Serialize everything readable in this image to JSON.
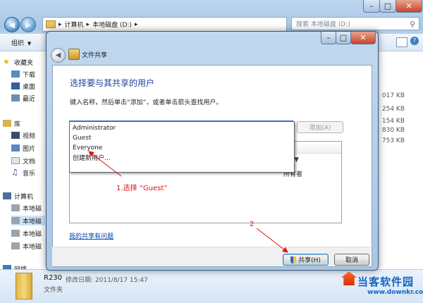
{
  "explorer": {
    "breadcrumb": [
      "计算机",
      "本地磁盘 (D:)"
    ],
    "search_placeholder": "搜索 本地磁盘 (D:)",
    "toolbar": {
      "organize_label": "组织"
    },
    "nav": {
      "favorites": "收藏夹",
      "downloads": "下载",
      "desktop": "桌面",
      "recent": "最近",
      "libraries": "库",
      "videos": "视频",
      "pictures": "图片",
      "documents": "文档",
      "music": "音乐",
      "computer": "计算机",
      "disk1": "本地磁",
      "disk2": "本地磁",
      "disk3": "本地磁",
      "disk4": "本地磁",
      "network": "网络"
    },
    "file_sizes": [
      "017 KB",
      "254 KB",
      "154 KB",
      "830 KB",
      "753 KB"
    ],
    "details": {
      "name": "R230",
      "modified": "修改日期: 2011/8/17 15:47",
      "type": "文件夹"
    }
  },
  "dialog": {
    "title": "文件共享",
    "heading": "选择要与其共享的用户",
    "instruction": "键入名称，然后单击“添加”，或者单击箭头查找用户。",
    "input_value": "",
    "add_button": "添加(A)",
    "dropdown_options": [
      "Administrator",
      "Guest",
      "Everyone",
      "创建新用户..."
    ],
    "list_fragment": "所有者",
    "trouble_link": "我的共享有问题",
    "share_button": "共享(H)",
    "cancel_button": "取消"
  },
  "annotations": {
    "step1": "1.选择 “Guest”",
    "step2": "2"
  },
  "watermark": {
    "brand": "当客软件园",
    "url": "www.downkr.com"
  },
  "colors": {
    "accent_heading": "#1f3f9e",
    "annotation_red": "#e01010",
    "link": "#0645ad"
  }
}
